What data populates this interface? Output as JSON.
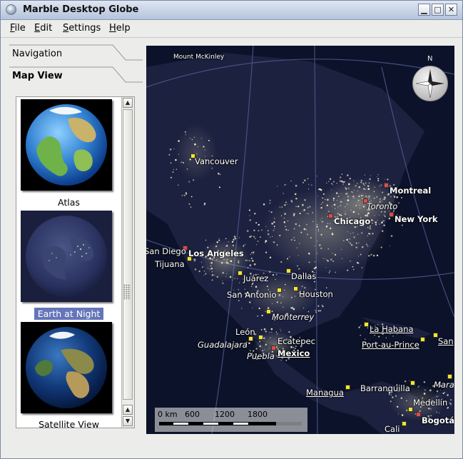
{
  "window": {
    "title": "Marble Desktop Globe",
    "buttons": {
      "minimize": "▁",
      "maximize": "□",
      "close": "✕"
    }
  },
  "menubar": {
    "items": [
      {
        "label": "File",
        "accel": "F",
        "rest": "ile"
      },
      {
        "label": "Edit",
        "accel": "E",
        "rest": "dit"
      },
      {
        "label": "Settings",
        "accel": "S",
        "rest": "ettings"
      },
      {
        "label": "Help",
        "accel": "H",
        "rest": "elp"
      }
    ]
  },
  "sidebar": {
    "tabs": [
      {
        "label": "Navigation",
        "active": false
      },
      {
        "label": "Map View",
        "active": true
      }
    ],
    "map_themes": [
      {
        "label": "Atlas",
        "selected": false
      },
      {
        "label": "Earth at Night",
        "selected": true
      },
      {
        "label": "Satellite View",
        "selected": false
      }
    ]
  },
  "map": {
    "compass_north": "N",
    "scale": {
      "ticks": [
        "0 km",
        "600",
        "1200",
        "1800"
      ]
    },
    "places": {
      "mount_mckinley": "Mount McKinley",
      "vancouver": "Vancouver",
      "montreal": "Montreal",
      "toronto": "Toronto",
      "chicago": "Chicago",
      "new_york": "New York",
      "san_diego": "San Diego",
      "los_angeles": "Los Angeles",
      "tijuana": "Tijuana",
      "juarez": "Juárez",
      "dallas": "Dallas",
      "san_antonio": "San Antonio",
      "houston": "Houston",
      "monterrey": "Monterrey",
      "la_habana": "La Habana",
      "leon": "León",
      "ecatepec": "Ecatepec",
      "guadalajara": "Guadalajara",
      "mexico": "Mexico",
      "puebla": "Puebla",
      "port_au_prince": "Port-au-Prince",
      "san_partial": "San",
      "managua": "Managua",
      "barranquilla": "Barranquilla",
      "mara_partial": "Mara",
      "medellin": "Medellín",
      "bogota": "Bogotá",
      "cali": "Cali"
    }
  },
  "colors": {
    "selection": "#6575b9",
    "capital_pin": "#e24a4a",
    "city_pin": "#f5e52a"
  }
}
